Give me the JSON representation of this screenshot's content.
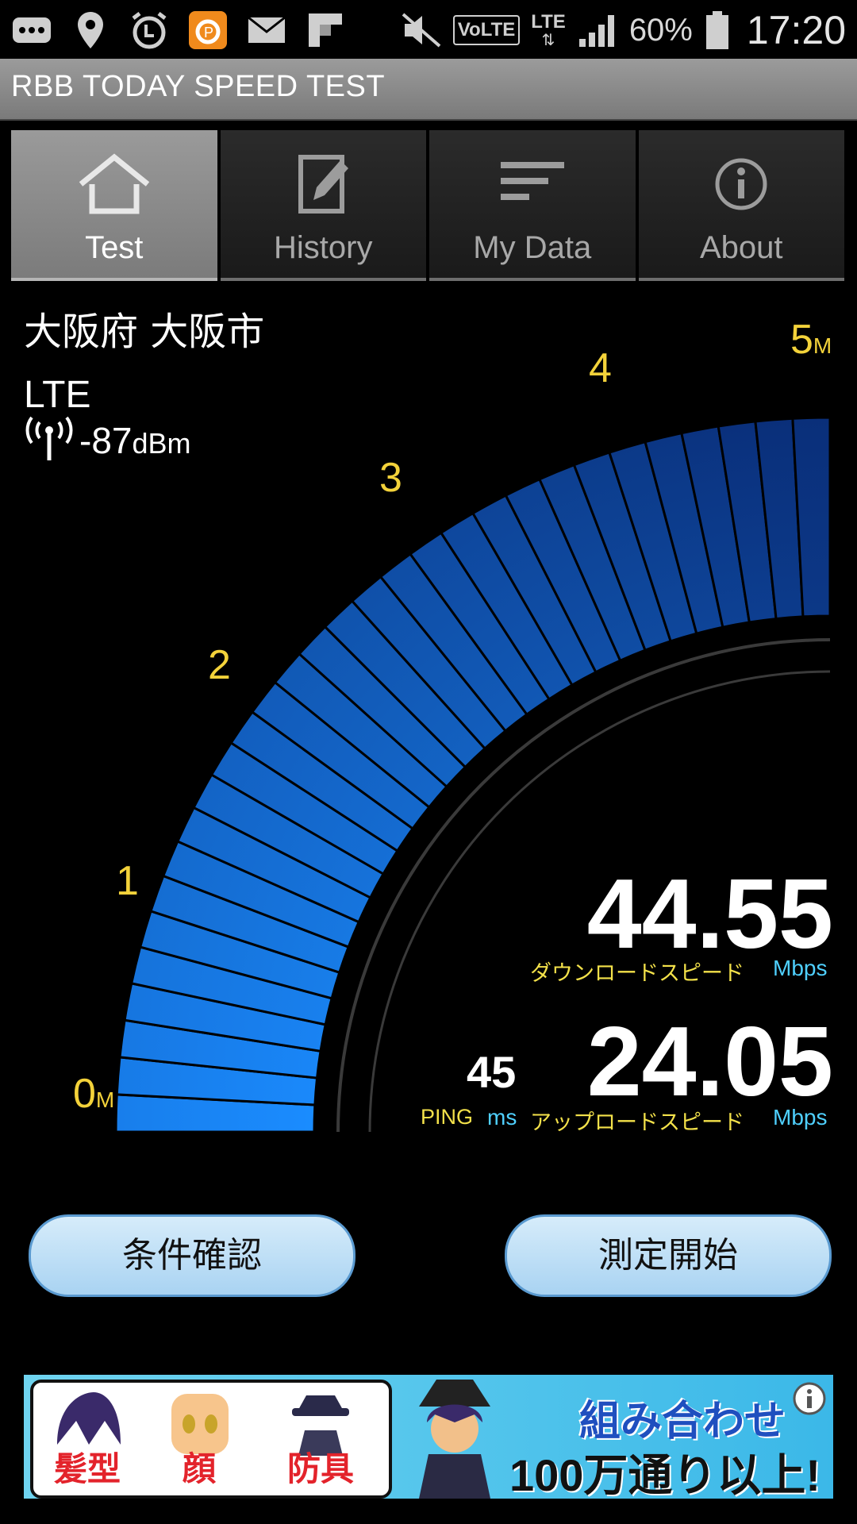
{
  "status_bar": {
    "network_type": "LTE",
    "volte": "VoLTE",
    "battery": "60%",
    "time": "17:20",
    "left_icons": [
      "more-icon",
      "location-pin-icon",
      "alarm-icon",
      "app-icon",
      "mail-icon",
      "flipboard-icon"
    ],
    "right_icons": [
      "mute-icon",
      "volte-icon",
      "lte-icon",
      "signal-bars-icon",
      "battery-icon"
    ]
  },
  "app": {
    "title": "RBB TODAY SPEED TEST"
  },
  "tabs": [
    {
      "label": "Test",
      "icon": "home-icon",
      "active": true
    },
    {
      "label": "History",
      "icon": "edit-icon",
      "active": false
    },
    {
      "label": "My Data",
      "icon": "list-icon",
      "active": false
    },
    {
      "label": "About",
      "icon": "info-icon",
      "active": false
    }
  ],
  "info": {
    "location": "大阪府 大阪市",
    "network": "LTE",
    "signal_value": "-87",
    "signal_unit": "dBm"
  },
  "gauge": {
    "labels": [
      "0",
      "1",
      "2",
      "3",
      "4",
      "5"
    ],
    "unit_suffix": "M",
    "level": 1.0,
    "colors": {
      "fill_start": "#1a8cff",
      "fill_end": "#0a2f7a",
      "label": "#f3d23a"
    }
  },
  "results": {
    "download_value": "44.55",
    "download_label": "ダウンロードスピード",
    "download_unit": "Mbps",
    "upload_value": "24.05",
    "upload_label": "アップロードスピード",
    "upload_unit": "Mbps",
    "ping_value": "45",
    "ping_label": "PING",
    "ping_unit": "ms"
  },
  "buttons": {
    "conditions": "条件確認",
    "start": "測定開始"
  },
  "ad": {
    "words": [
      "髪型",
      "顔",
      "防具"
    ],
    "line1": "組み合わせ",
    "line2": "100万通り以上!"
  }
}
